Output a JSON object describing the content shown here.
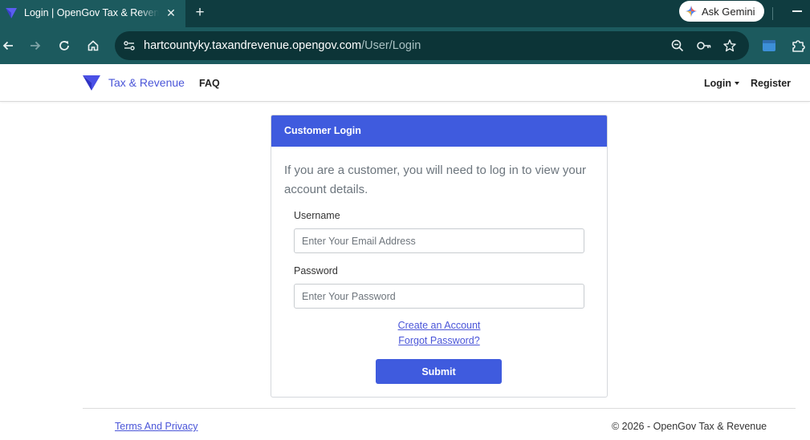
{
  "browser": {
    "tab_title": "Login | OpenGov Tax & Revenue",
    "close_glyph": "✕",
    "new_tab_glyph": "+",
    "gemini_label": "Ask Gemini",
    "url_host": "hartcountyky.taxandrevenue.opengov.com",
    "url_path": "/User/Login",
    "icons": [
      "back-icon",
      "forward-icon",
      "reload-icon",
      "home-icon",
      "site-info-icon",
      "zoom-icon",
      "key-icon",
      "star-icon",
      "extension-icon",
      "puzzle-icon"
    ]
  },
  "navbar": {
    "brand": "Tax & Revenue",
    "faq": "FAQ",
    "login": "Login",
    "register": "Register"
  },
  "login_card": {
    "title": "Customer Login",
    "intro": "If you are a customer, you will need to log in to view your account details.",
    "username_label": "Username",
    "username_placeholder": "Enter Your Email Address",
    "password_label": "Password",
    "password_placeholder": "Enter Your Password",
    "create_account": "Create an Account",
    "forgot_password": "Forgot Password?",
    "submit": "Submit"
  },
  "footer": {
    "terms": "Terms And Privacy",
    "copyright": "© 2026 - OpenGov Tax & Revenue"
  },
  "colors": {
    "accent": "#3f5bde",
    "link": "#4a55d8",
    "chrome_dark": "#0f3c40",
    "chrome_toolbar": "#1c5a5e"
  }
}
